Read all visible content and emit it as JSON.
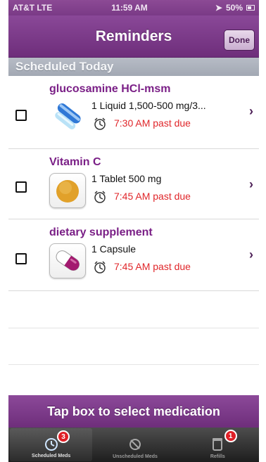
{
  "status_bar": {
    "carrier": "AT&T LTE",
    "time": "11:59 AM",
    "battery": "50%"
  },
  "nav": {
    "title": "Reminders",
    "done_label": "Done"
  },
  "section": {
    "title": "Scheduled Today"
  },
  "reminders": [
    {
      "name": "glucosamine HCl-msm",
      "dose": "1 Liquid 1,500-500 mg/3...",
      "time": "7:30 AM past due",
      "icon": "liquid-capsule-icon"
    },
    {
      "name": "Vitamin C",
      "dose": "1 Tablet 500 mg",
      "time": "7:45 AM past due",
      "icon": "tablet-icon"
    },
    {
      "name": "dietary supplement",
      "dose": "1 Capsule",
      "time": "7:45 AM past due",
      "icon": "capsule-icon"
    }
  ],
  "bottom_banner": {
    "text": "Tap box to select medication"
  },
  "tabs": [
    {
      "label": "Scheduled Meds",
      "badge": "3",
      "icon": "alarm-clock-icon",
      "active": true
    },
    {
      "label": "Unscheduled Meds",
      "badge": "",
      "icon": "bell-slash-icon",
      "active": false
    },
    {
      "label": "Refills",
      "badge": "1",
      "icon": "pill-bottle-icon",
      "active": false
    }
  ],
  "colors": {
    "brand_purple": "#7a3a86",
    "medication_name": "#7a1f86",
    "past_due_red": "#e0262a",
    "badge_red": "#df1f26"
  }
}
